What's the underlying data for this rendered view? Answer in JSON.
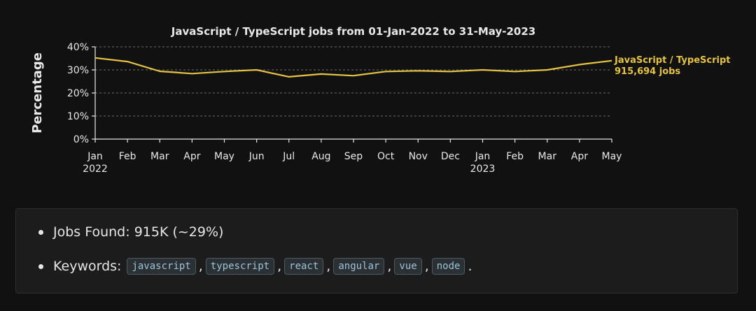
{
  "chart_data": {
    "type": "line",
    "title": "JavaScript / TypeScript jobs from 01-Jan-2022 to 31-May-2023",
    "ylabel": "Percentage",
    "xlabel": "",
    "ylim": [
      0,
      40
    ],
    "y_ticks": [
      "0%",
      "10%",
      "20%",
      "30%",
      "40%"
    ],
    "x": [
      "2022-01",
      "2022-02",
      "2022-03",
      "2022-04",
      "2022-05",
      "2022-06",
      "2022-07",
      "2022-08",
      "2022-09",
      "2022-10",
      "2022-11",
      "2022-12",
      "2023-01",
      "2023-02",
      "2023-03",
      "2023-04",
      "2023-05"
    ],
    "x_tick_labels": [
      "Jan",
      "Feb",
      "Mar",
      "Apr",
      "May",
      "Jun",
      "Jul",
      "Aug",
      "Sep",
      "Oct",
      "Nov",
      "Dec",
      "Jan",
      "Feb",
      "Mar",
      "Apr",
      "May"
    ],
    "x_year_labels": [
      {
        "index": 0,
        "label": "2022"
      },
      {
        "index": 12,
        "label": "2023"
      }
    ],
    "grid": true,
    "series": [
      {
        "name": "JavaScript / TypeScript",
        "color": "#e5c444",
        "values": [
          35.2,
          33.6,
          29.4,
          28.4,
          29.3,
          30.0,
          27.0,
          28.2,
          27.5,
          29.3,
          29.6,
          29.3,
          30.0,
          29.3,
          30.0,
          32.3,
          34.0
        ],
        "end_label": [
          "JavaScript / TypeScript",
          "915,694 jobs"
        ]
      }
    ]
  },
  "info": {
    "jobs_found_text": "Jobs Found: 915K (~29%)",
    "keywords_label": "Keywords:",
    "keywords": [
      "javascript",
      "typescript",
      "react",
      "angular",
      "vue",
      "node"
    ],
    "keyword_separator": ",",
    "keyword_terminator": "."
  }
}
